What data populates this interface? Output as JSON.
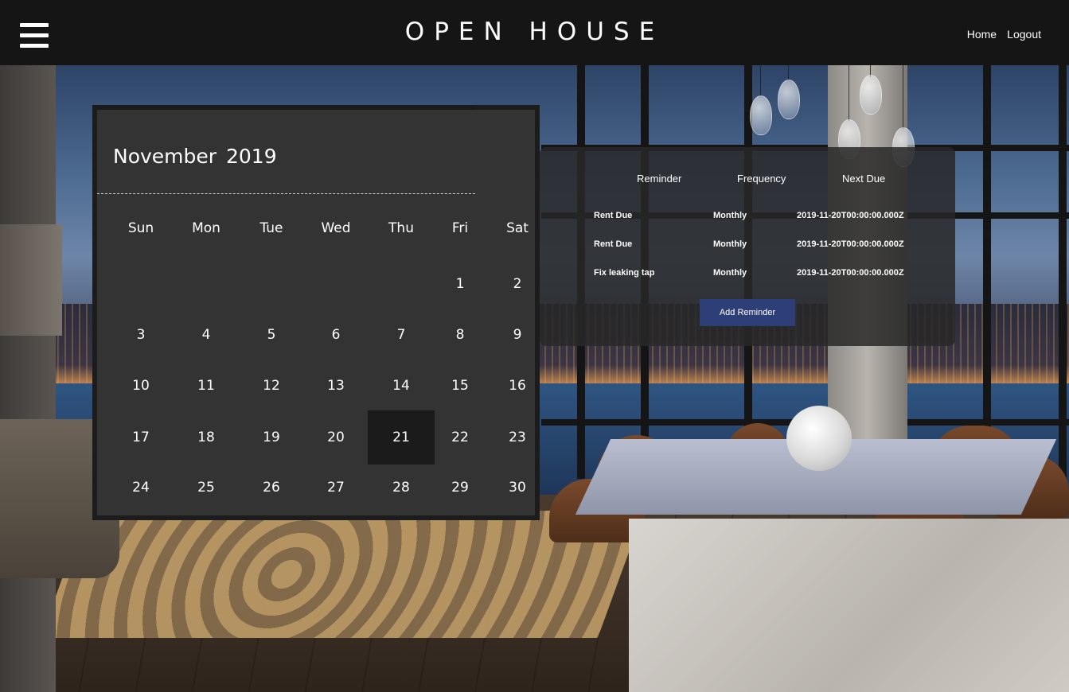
{
  "header": {
    "brand": "OPEN HOUSE",
    "nav": [
      {
        "label": "Home"
      },
      {
        "label": "Logout"
      }
    ]
  },
  "calendar": {
    "title": "November 2019",
    "weekdays": [
      "Sun",
      "Mon",
      "Tue",
      "Wed",
      "Thu",
      "Fri",
      "Sat"
    ],
    "weeks": [
      [
        "",
        "",
        "",
        "",
        "",
        "1",
        "2"
      ],
      [
        "3",
        "4",
        "5",
        "6",
        "7",
        "8",
        "9"
      ],
      [
        "10",
        "11",
        "12",
        "13",
        "14",
        "15",
        "16"
      ],
      [
        "17",
        "18",
        "19",
        "20",
        "21",
        "22",
        "23"
      ],
      [
        "24",
        "25",
        "26",
        "27",
        "28",
        "29",
        "30"
      ]
    ],
    "selected_day": "21"
  },
  "reminders": {
    "headers": {
      "reminder": "Reminder",
      "frequency": "Frequency",
      "next_due": "Next Due"
    },
    "rows": [
      {
        "reminder": "Rent Due",
        "frequency": "Monthly",
        "next_due": "2019-11-20T00:00:00.000Z"
      },
      {
        "reminder": "Rent Due",
        "frequency": "Monthly",
        "next_due": "2019-11-20T00:00:00.000Z"
      },
      {
        "reminder": "Fix leaking tap",
        "frequency": "Monthly",
        "next_due": "2019-11-20T00:00:00.000Z"
      }
    ],
    "add_button_label": "Add Reminder"
  },
  "colors": {
    "header_bg": "#151515",
    "calendar_bg": "#333333",
    "selected_day_bg": "#1b1b1b",
    "add_button_bg": "#2e3f78"
  }
}
